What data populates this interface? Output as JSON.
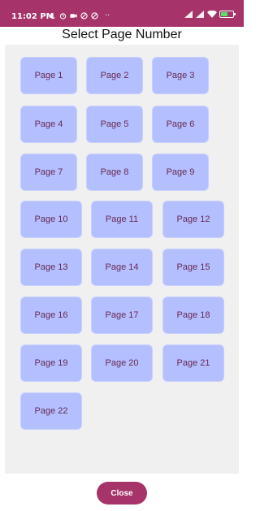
{
  "status_bar": {
    "time": "11:02 PM",
    "left_icons": [
      "moon-icon",
      "alarm-icon",
      "video-icon",
      "blocked-icon",
      "blocked-icon"
    ],
    "more": "··",
    "right_icons": [
      "signal-icon",
      "signal-icon",
      "wifi-icon",
      "battery-icon"
    ],
    "battery_color": "#55e26b",
    "bar_color": "#a63369"
  },
  "dialog": {
    "title": "Select Page Number",
    "pages": [
      "Page 1",
      "Page 2",
      "Page 3",
      "Page 4",
      "Page 5",
      "Page 6",
      "Page 7",
      "Page 8",
      "Page 9",
      "Page 10",
      "Page 11",
      "Page 12",
      "Page 13",
      "Page 14",
      "Page 15",
      "Page 16",
      "Page 17",
      "Page 18",
      "Page 19",
      "Page 20",
      "Page 21",
      "Page 22"
    ],
    "button_color": "#b3bfff",
    "button_text_color": "#6a2a52",
    "close_label": "Close",
    "close_color": "#a63369"
  }
}
